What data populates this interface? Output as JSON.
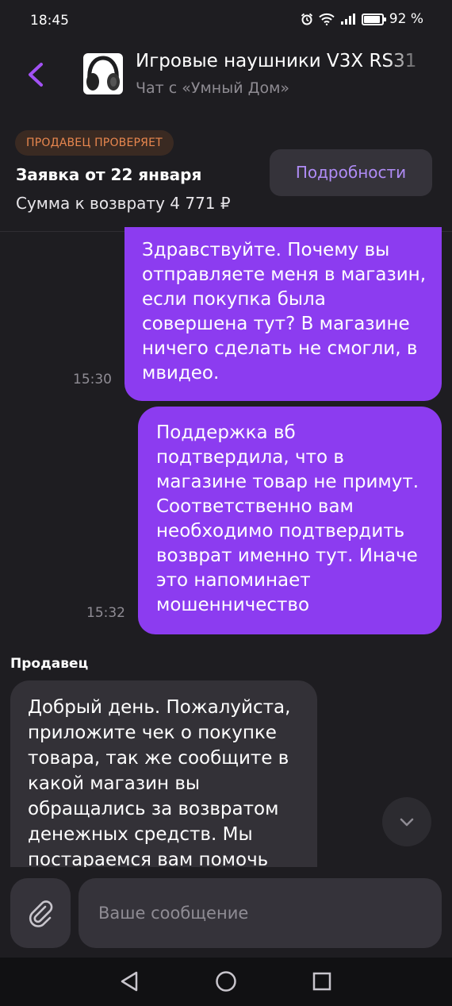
{
  "status_bar": {
    "time": "18:45",
    "battery": "92 %",
    "battery_level": 0.92
  },
  "header": {
    "back_icon": "chevron-left-icon",
    "product_thumbnail": "headphones-thumbnail",
    "title": "Игровые наушники V3X RS31",
    "subtitle": "Чат с «Умный Дом»"
  },
  "claim": {
    "status_badge": "ПРОДАВЕЦ ПРОВЕРЯЕТ",
    "date_line": "Заявка от 22 января",
    "refund_line": "Сумма к возврату 4 771 ₽",
    "details_button": "Подробности"
  },
  "messages": [
    {
      "direction": "outgoing",
      "time": "15:30",
      "text": "Здравствуйте. Почему вы отправляете меня в магазин, если покупка была совершена тут? В магазине ничего сделать не смогли, в мвидео."
    },
    {
      "direction": "outgoing",
      "time": "15:32",
      "text": "Поддержка вб подтвердила, что в магазине товар не примут. Соответственно вам необходимо подтвердить возврат именно тут. Иначе это напоминает мошенничество"
    },
    {
      "direction": "incoming",
      "sender": "Продавец",
      "text": "Добрый день. Пожалуйста, приложите чек о покупке товара, так же сообщите в какой магазин вы обращались за возвратом денежных средств. Мы постараемся вам помочь"
    }
  ],
  "composer": {
    "attach_icon": "paperclip-icon",
    "placeholder": "Ваше сообщение"
  },
  "colors": {
    "accent": "#8c3cf0",
    "background": "#1e1d21",
    "badge_text": "#e8874f",
    "link": "#b08cf6"
  }
}
